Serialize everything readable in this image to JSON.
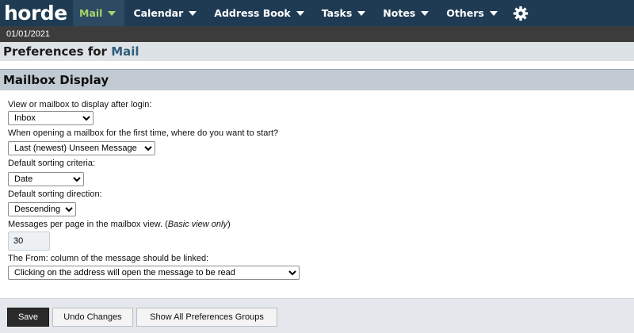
{
  "brand": {
    "logo_text": "horde"
  },
  "nav": {
    "items": [
      {
        "label": "Mail",
        "active": true,
        "has_menu": true
      },
      {
        "label": "Calendar",
        "has_menu": true
      },
      {
        "label": "Address Book",
        "has_menu": true
      },
      {
        "label": "Tasks",
        "has_menu": true
      },
      {
        "label": "Notes",
        "has_menu": true
      },
      {
        "label": "Others",
        "has_menu": true
      }
    ],
    "settings_icon": "gear-icon"
  },
  "date": "01/01/2021",
  "page": {
    "title_prefix": "Preferences for ",
    "title_app": "Mail",
    "section": "Mailbox Display"
  },
  "form": {
    "login_mailbox": {
      "label": "View or mailbox to display after login:",
      "value": "Inbox"
    },
    "first_open": {
      "label": "When opening a mailbox for the first time, where do you want to start?",
      "value": "Last (newest) Unseen Message"
    },
    "sort_criteria": {
      "label": "Default sorting criteria:",
      "value": "Date"
    },
    "sort_direction": {
      "label": "Default sorting direction:",
      "value": "Descending"
    },
    "per_page": {
      "label": "Messages per page in the mailbox view. (",
      "label_em": "Basic view only",
      "label_end": ")",
      "value": "30"
    },
    "from_link": {
      "label": "The From: column of the message should be linked:",
      "value": "Clicking on the address will open the message to be read"
    }
  },
  "buttons": {
    "save": "Save",
    "undo": "Undo Changes",
    "show_all": "Show All Preferences Groups"
  },
  "colors": {
    "topbar": "#1f3b53",
    "active_nav_text": "#a8d36a",
    "section_header": "#c2cbd3"
  }
}
